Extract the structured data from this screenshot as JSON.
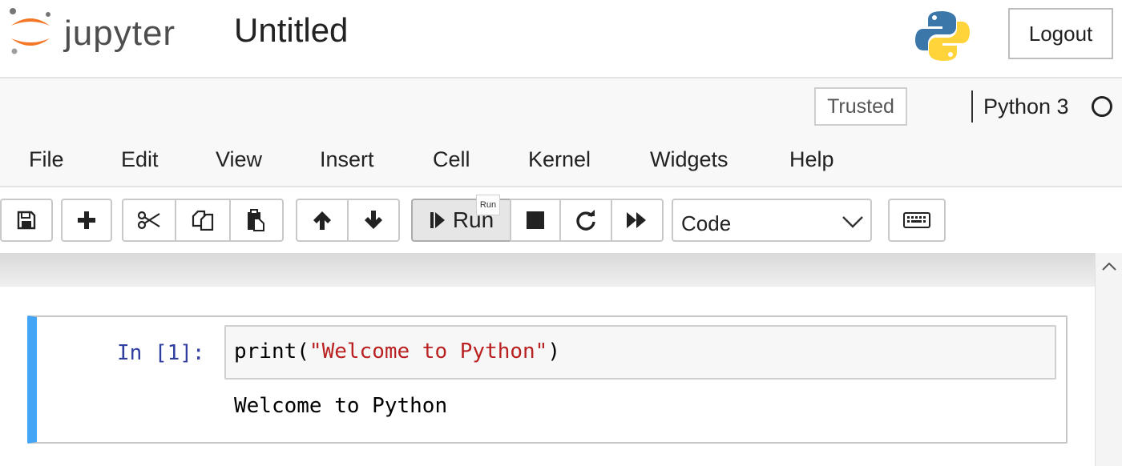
{
  "header": {
    "logo_text": "jupyter",
    "notebook_title": "Untitled",
    "logout_label": "Logout"
  },
  "status": {
    "trusted_label": "Trusted",
    "kernel_name": "Python 3"
  },
  "menu": {
    "items": [
      "File",
      "Edit",
      "View",
      "Insert",
      "Cell",
      "Kernel",
      "Widgets",
      "Help"
    ]
  },
  "toolbar": {
    "buttons": [
      {
        "name": "save-button",
        "icon": "floppy-disk-icon"
      },
      {
        "name": "insert-cell-button",
        "icon": "plus-icon"
      },
      {
        "name": "cut-button",
        "icon": "scissors-icon"
      },
      {
        "name": "copy-button",
        "icon": "copy-icon"
      },
      {
        "name": "paste-button",
        "icon": "paste-icon"
      },
      {
        "name": "move-up-button",
        "icon": "arrow-up-icon"
      },
      {
        "name": "move-down-button",
        "icon": "arrow-down-icon"
      },
      {
        "name": "interrupt-button",
        "icon": "stop-icon"
      },
      {
        "name": "restart-button",
        "icon": "restart-icon"
      },
      {
        "name": "restart-run-all-button",
        "icon": "fast-forward-icon"
      },
      {
        "name": "command-palette-button",
        "icon": "keyboard-icon"
      }
    ],
    "run_label": "Run",
    "run_tooltip": "Run",
    "cell_type": "Code"
  },
  "cell": {
    "prompt": "In [1]:",
    "code_func": "print(",
    "code_string": "\"Welcome to Python\"",
    "code_close": ")",
    "output": "Welcome to Python"
  },
  "colors": {
    "cell_selected_border": "#42a5f5",
    "prompt_color": "#303f9f",
    "string_color": "#ba2121"
  }
}
